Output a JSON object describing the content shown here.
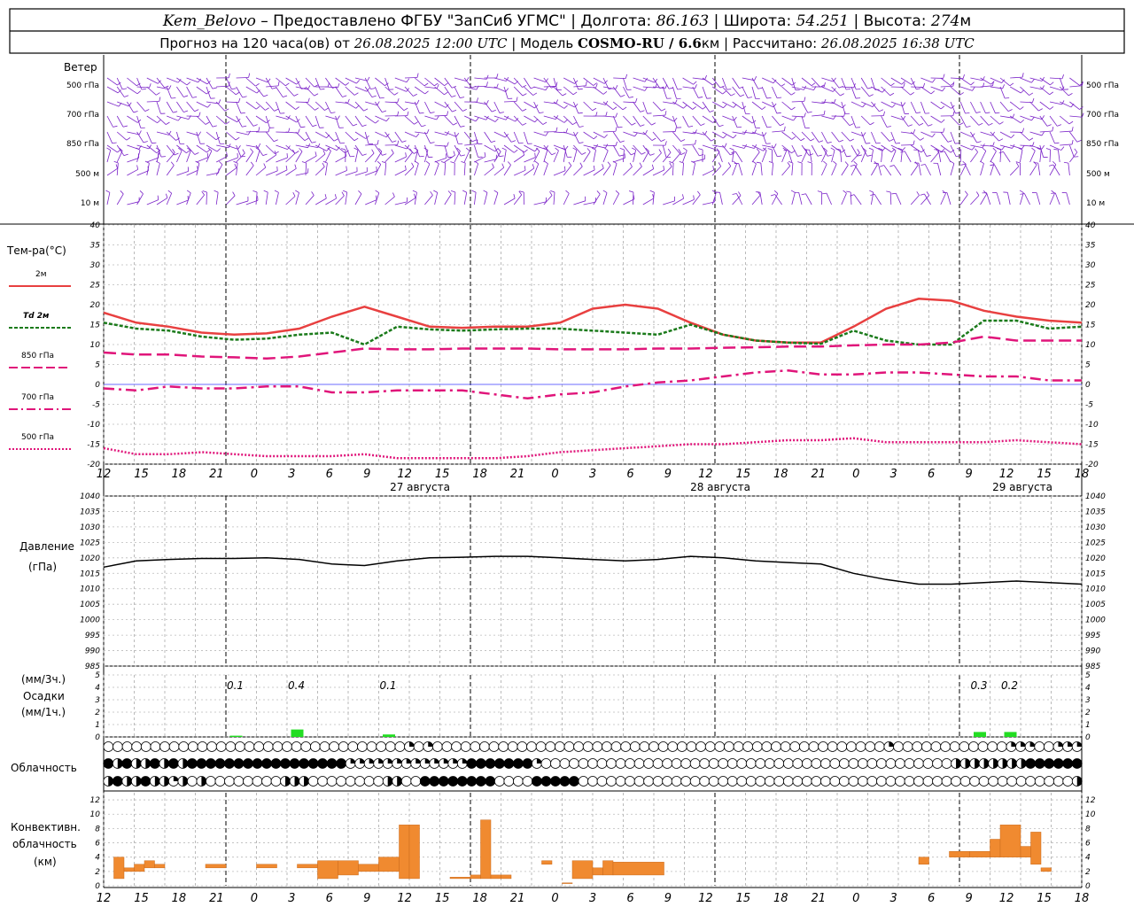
{
  "header": {
    "station": "Kem_Belovo",
    "provided": " – Предоставлено ФГБУ \"ЗапСиб УГМС\" | Долгота: ",
    "lon": "86.163",
    "lat_label": " | Широта: ",
    "lat": "54.251",
    "alt_label": " | Высота: ",
    "alt": "274",
    "alt_unit": "м",
    "forecast_label": "Прогноз на 120 часа(ов) от ",
    "forecast_from": "26.08.2025 12:00 UTC",
    "model_label": " | Модель ",
    "model": "COSMO-RU / 6.6",
    "model_unit": "км",
    "calc_label": " | Рассчитано: ",
    "calc_time": "26.08.2025 16:38 UTC"
  },
  "panels": {
    "wind": {
      "title": "Ветер",
      "levels": [
        "500 гПа",
        "700 гПа",
        "850 гПа",
        "500 м",
        "10 м"
      ]
    },
    "temperature": {
      "title": "Тем-ра(°С)",
      "legend": [
        "2м",
        "Td 2м",
        "850 гПа",
        "700 гПа",
        "500 гПа"
      ],
      "yticks": [
        40,
        35,
        30,
        25,
        20,
        15,
        10,
        5,
        0,
        -5,
        -10,
        -15,
        -20
      ]
    },
    "pressure": {
      "title": "Давление",
      "unit": "(гПа)",
      "yticks": [
        1040,
        1035,
        1030,
        1025,
        1020,
        1015,
        1010,
        1005,
        1000,
        995,
        990,
        985
      ]
    },
    "precip": {
      "title": "Осадки",
      "unit_3h": "(мм/3ч.)",
      "unit_1h": "(мм/1ч.)",
      "yticks": [
        5,
        4,
        3,
        2,
        1,
        0
      ],
      "amounts": [
        {
          "hour": 13,
          "label": "0.1"
        },
        {
          "hour": 19,
          "label": "0.4"
        },
        {
          "hour": 28,
          "label": "0.1"
        },
        {
          "hour": 86,
          "label": "0.3"
        },
        {
          "hour": 89,
          "label": "0.2"
        }
      ]
    },
    "cloud": {
      "title": "Облачность"
    },
    "convective": {
      "title": "Конвективн.",
      "title2": "облачность",
      "unit": "(км)",
      "yticks": [
        12,
        10,
        8,
        6,
        4,
        2,
        0
      ]
    }
  },
  "x_axis": {
    "hour_labels": [
      "12",
      "15",
      "18",
      "21",
      "0",
      "3",
      "6",
      "9",
      "12",
      "15",
      "18",
      "21",
      "0",
      "3",
      "6",
      "9",
      "12",
      "15",
      "18",
      "21",
      "0",
      "3",
      "6",
      "9",
      "12",
      "15",
      "18"
    ],
    "dates": [
      "27 августа",
      "28 августа",
      "29 августа"
    ]
  },
  "colors": {
    "wind": "#7a22c8",
    "temp2m": "#e84040",
    "td": "#1a7a1a",
    "levels": "#e0157a",
    "precip": "#22dd22",
    "convective": "#f08a30"
  },
  "chart_data": {
    "type": "line",
    "x_unit": "hours from 26.08.2025 12:00 UTC",
    "x": [
      0,
      3,
      6,
      9,
      12,
      15,
      18,
      21,
      24,
      27,
      30,
      33,
      36,
      39,
      42,
      45,
      48,
      51,
      54,
      57,
      60,
      63,
      66,
      69,
      72,
      75,
      78,
      81,
      84,
      87,
      90
    ],
    "series": [
      {
        "name": "2м",
        "values": [
          18,
          15.5,
          14.5,
          13,
          12.5,
          12.8,
          14,
          17,
          19.5,
          17,
          14.5,
          14.2,
          14.5,
          14.5,
          15.5,
          19,
          20,
          19,
          15.5,
          12.5,
          11,
          10.5,
          10.5,
          14.5,
          19,
          21.5,
          21,
          18.5,
          17,
          16,
          15.5
        ]
      },
      {
        "name": "Td 2м",
        "values": [
          15.5,
          14,
          13.5,
          12,
          11.2,
          11.5,
          12.5,
          13,
          10,
          14.5,
          13.8,
          13.5,
          13.8,
          14,
          14,
          13.5,
          13,
          12.5,
          15,
          12.5,
          11,
          10.5,
          10.2,
          13.5,
          11,
          10,
          10,
          16,
          16,
          14,
          14.5
        ]
      },
      {
        "name": "850 гПа",
        "values": [
          8,
          7.5,
          7.5,
          7,
          6.8,
          6.5,
          7,
          8,
          9,
          8.8,
          8.8,
          9,
          9,
          9,
          8.8,
          8.8,
          8.8,
          9,
          9,
          9.2,
          9.3,
          9.5,
          9.5,
          9.8,
          10,
          10,
          10.5,
          12,
          11,
          11,
          11
        ]
      },
      {
        "name": "700 гПа",
        "values": [
          -1,
          -1.5,
          -0.5,
          -1,
          -1,
          -0.5,
          -0.5,
          -2,
          -2,
          -1.5,
          -1.5,
          -1.5,
          -2.5,
          -3.5,
          -2.5,
          -2,
          -0.5,
          0.5,
          1,
          2,
          3,
          3.5,
          2.5,
          2.5,
          3,
          3,
          2.5,
          2,
          2,
          1,
          1
        ]
      },
      {
        "name": "500 гПа",
        "values": [
          -16,
          -17.5,
          -17.5,
          -17,
          -17.5,
          -18,
          -18,
          -18,
          -17.5,
          -18.5,
          -18.5,
          -18.5,
          -18.5,
          -18,
          -17,
          -16.5,
          -16,
          -15.5,
          -15,
          -15,
          -14.5,
          -14,
          -14,
          -13.5,
          -14.5,
          -14.5,
          -14.5,
          -14.5,
          -14,
          -14.5,
          -15
        ]
      },
      {
        "name": "Давление",
        "values": [
          1017,
          1019,
          1019.5,
          1019.8,
          1019.8,
          1020,
          1019.5,
          1018,
          1017.5,
          1019,
          1020,
          1020.2,
          1020.5,
          1020.5,
          1020,
          1019.5,
          1019,
          1019.5,
          1020.5,
          1020,
          1019,
          1018.5,
          1018,
          1015,
          1013,
          1011.5,
          1011.5,
          1012,
          1012.5,
          1012,
          1011.5
        ]
      }
    ],
    "precip_1h": [
      {
        "hour": 13,
        "value": 0.1
      },
      {
        "hour": 19,
        "value": 0.6
      },
      {
        "hour": 28,
        "value": 0.2
      },
      {
        "hour": 86,
        "value": 0.4
      },
      {
        "hour": 89,
        "value": 0.4
      }
    ],
    "convective_cloud": [
      {
        "from": 1,
        "to": 2,
        "base": 1,
        "top": 4
      },
      {
        "from": 2,
        "to": 3,
        "base": 2,
        "top": 2.5
      },
      {
        "from": 3,
        "to": 4,
        "base": 2,
        "top": 3
      },
      {
        "from": 4,
        "to": 5,
        "base": 2.5,
        "top": 3.5
      },
      {
        "from": 5,
        "to": 6,
        "base": 2.5,
        "top": 3
      },
      {
        "from": 10,
        "to": 12,
        "base": 2.5,
        "top": 3
      },
      {
        "from": 15,
        "to": 17,
        "base": 2.5,
        "top": 3
      },
      {
        "from": 19,
        "to": 21,
        "base": 2.5,
        "top": 3
      },
      {
        "from": 21,
        "to": 23,
        "base": 1,
        "top": 3.5
      },
      {
        "from": 23,
        "to": 25,
        "base": 1.5,
        "top": 3.5
      },
      {
        "from": 25,
        "to": 27,
        "base": 2,
        "top": 3
      },
      {
        "from": 27,
        "to": 29,
        "base": 2,
        "top": 4
      },
      {
        "from": 29,
        "to": 30,
        "base": 1,
        "top": 8.5
      },
      {
        "from": 30,
        "to": 31,
        "base": 1,
        "top": 8.5
      },
      {
        "from": 34,
        "to": 36,
        "base": 1,
        "top": 1.2
      },
      {
        "from": 36,
        "to": 37,
        "base": 1,
        "top": 1.5
      },
      {
        "from": 37,
        "to": 38,
        "base": 1,
        "top": 9.2
      },
      {
        "from": 38,
        "to": 39,
        "base": 1,
        "top": 1.5
      },
      {
        "from": 39,
        "to": 40,
        "base": 1,
        "top": 1.5
      },
      {
        "from": 43,
        "to": 44,
        "base": 3,
        "top": 3.5
      },
      {
        "from": 45,
        "to": 46,
        "base": 0.3,
        "top": 0.4
      },
      {
        "from": 46,
        "to": 48,
        "base": 1,
        "top": 3.5
      },
      {
        "from": 48,
        "to": 49,
        "base": 1.5,
        "top": 2.5
      },
      {
        "from": 49,
        "to": 50,
        "base": 1.5,
        "top": 3.5
      },
      {
        "from": 50,
        "to": 55,
        "base": 1.5,
        "top": 3.3
      },
      {
        "from": 80,
        "to": 81,
        "base": 3,
        "top": 4
      },
      {
        "from": 83,
        "to": 85,
        "base": 4,
        "top": 4.8
      },
      {
        "from": 85,
        "to": 87,
        "base": 4,
        "top": 4.8
      },
      {
        "from": 87,
        "to": 88,
        "base": 4,
        "top": 6.5
      },
      {
        "from": 88,
        "to": 90,
        "base": 4,
        "top": 8.5
      },
      {
        "from": 90,
        "to": 91,
        "base": 4,
        "top": 5.5
      },
      {
        "from": 91,
        "to": 92,
        "base": 3,
        "top": 7.5
      },
      {
        "from": 92,
        "to": 93,
        "base": 2,
        "top": 2.5
      }
    ],
    "cloud_rows": {
      "upper": "ooooooooooooooooooooooooooooooooqoqooooooooooooooooooooooooooooooooooooooooooooooooqooooooooooooqqqooqqq",
      "middle": "xhxhhxhxhxxxxxxxxxxxxxxxxxqqqqqqqqqqqqqxxxxxxxqoooooooooooooooooooooooooooooooooooooooooooohhhhhhhhxxxxxx",
      "lower": "hxhhxhhqhohoooooooohhhoooooooohhooxxxxxxxxooooxxxxxoooooooooooooooooooooooooooooooooooooooooooooooooooooh"
    },
    "xlim": [
      0,
      120
    ],
    "ylim_temp": [
      -20,
      40
    ],
    "ylim_pressure": [
      985,
      1040
    ],
    "ylim_precip": [
      0,
      5
    ],
    "ylim_convective": [
      0,
      12
    ]
  }
}
